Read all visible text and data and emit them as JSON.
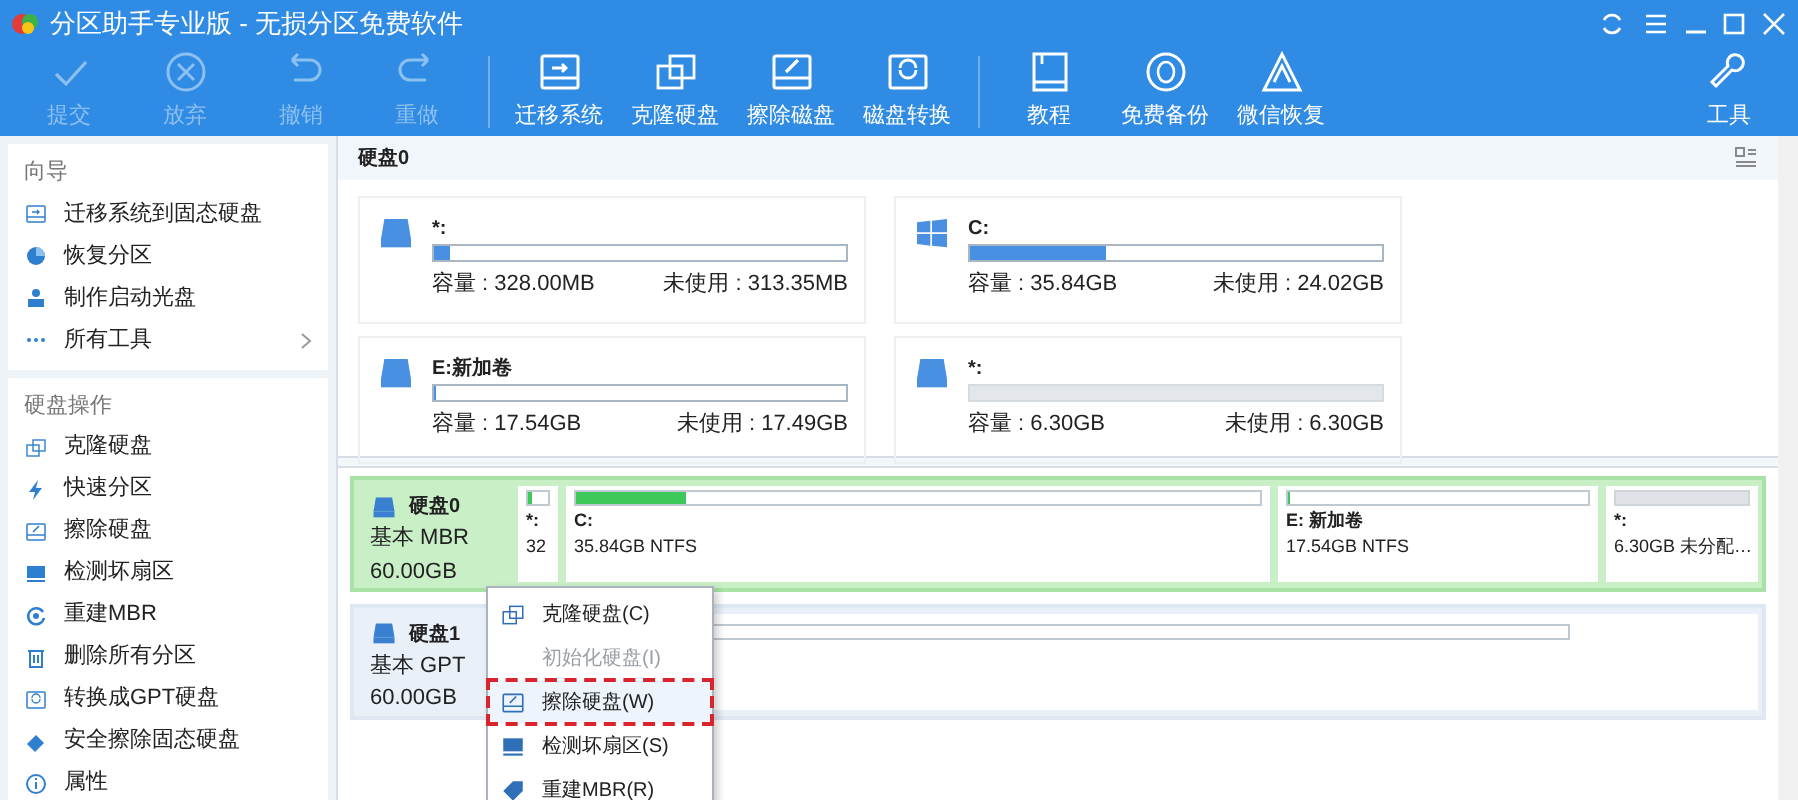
{
  "window": {
    "title": "分区助手专业版 - 无损分区免费软件"
  },
  "toolbar": [
    {
      "label": "提交",
      "disabled": true
    },
    {
      "label": "放弃",
      "disabled": true
    },
    {
      "label": "撤销",
      "disabled": true
    },
    {
      "label": "重做",
      "disabled": true
    },
    {
      "label": "迁移系统",
      "disabled": false
    },
    {
      "label": "克隆硬盘",
      "disabled": false
    },
    {
      "label": "擦除磁盘",
      "disabled": false
    },
    {
      "label": "磁盘转换",
      "disabled": false
    },
    {
      "label": "教程",
      "disabled": false
    },
    {
      "label": "免费备份",
      "disabled": false
    },
    {
      "label": "微信恢复",
      "disabled": false
    }
  ],
  "tools_button": {
    "label": "工具"
  },
  "sidebar": [
    {
      "title": "向导",
      "items": [
        {
          "label": "迁移系统到固态硬盘",
          "expand": false
        },
        {
          "label": "恢复分区",
          "expand": false
        },
        {
          "label": "制作启动光盘",
          "expand": false
        },
        {
          "label": "所有工具",
          "expand": true
        }
      ]
    },
    {
      "title": "硬盘操作",
      "items": [
        {
          "label": "克隆硬盘",
          "expand": false
        },
        {
          "label": "快速分区",
          "expand": false
        },
        {
          "label": "擦除硬盘",
          "expand": false
        },
        {
          "label": "检测坏扇区",
          "expand": false
        },
        {
          "label": "重建MBR",
          "expand": false
        },
        {
          "label": "删除所有分区",
          "expand": false
        },
        {
          "label": "转换成GPT硬盘",
          "expand": false
        },
        {
          "label": "安全擦除固态硬盘",
          "expand": false
        },
        {
          "label": "属性",
          "expand": false
        }
      ]
    }
  ],
  "disk_header": "硬盘0",
  "partition_cards": [
    {
      "name": "*:",
      "kind": "drive",
      "level": 0.04,
      "capacity": "容量 : 328.00MB",
      "free": "未使用 : 313.35MB"
    },
    {
      "name": "C:",
      "kind": "windows",
      "level": 0.33,
      "capacity": "容量 : 35.84GB",
      "free": "未使用 : 24.02GB"
    },
    {
      "name": "E:新加卷",
      "kind": "drive",
      "level": 0.003,
      "capacity": "容量 : 17.54GB",
      "free": "未使用 : 17.49GB"
    },
    {
      "name": "*:",
      "kind": "unallocated",
      "capacity": "容量 : 6.30GB",
      "free": "未使用 : 6.30GB"
    }
  ],
  "disks": [
    {
      "name": "硬盘0",
      "type": "基本 MBR",
      "size": "60.00GB",
      "selected": true,
      "partitions": [
        {
          "name": "*:",
          "info": "32",
          "kind": "drive",
          "level": 0.2
        },
        {
          "name": "C:",
          "info": "35.84GB NTFS",
          "kind": "drive",
          "level": 0.16
        },
        {
          "name": "E: 新加卷",
          "info": "17.54GB NTFS",
          "kind": "drive",
          "level": 0.003
        },
        {
          "name": "*:",
          "info": "6.30GB 未分配…",
          "kind": "unallocated"
        }
      ]
    },
    {
      "name": "硬盘1",
      "type": "基本 GPT",
      "size": "60.00GB",
      "selected": false
    }
  ],
  "context_menu": [
    {
      "label": "克隆硬盘(C)",
      "disabled": false,
      "highlighted": false
    },
    {
      "label": "初始化硬盘(I)",
      "disabled": true,
      "highlighted": false
    },
    {
      "label": "擦除硬盘(W)",
      "disabled": false,
      "highlighted": true
    },
    {
      "label": "检测坏扇区(S)",
      "disabled": false,
      "highlighted": false
    },
    {
      "label": "重建MBR(R)",
      "disabled": false,
      "highlighted": false
    }
  ]
}
